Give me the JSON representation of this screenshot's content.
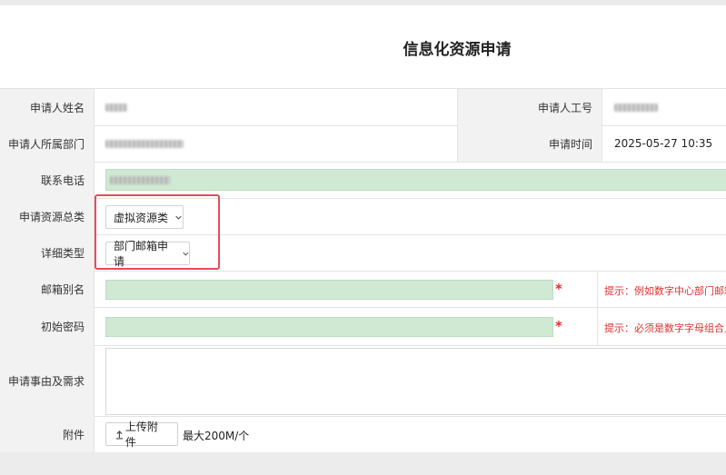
{
  "page": {
    "title": "信息化资源申请"
  },
  "fields": {
    "applicant_name": {
      "label": "申请人姓名"
    },
    "employee_id": {
      "label": "申请人工号"
    },
    "department": {
      "label": "申请人所属部门"
    },
    "apply_time": {
      "label": "申请时间",
      "value": "2025-05-27 10:35"
    },
    "phone": {
      "label": "联系电话"
    },
    "resource_category": {
      "label": "申请资源总类",
      "value": "虚拟资源类"
    },
    "detail_type": {
      "label": "详细类型",
      "value": "部门邮箱申请"
    },
    "mailbox_alias": {
      "label": "邮箱别名",
      "required_mark": "*",
      "hint": "提示：例如数字中心部门邮箱"
    },
    "initial_password": {
      "label": "初始密码",
      "required_mark": "*",
      "hint": "提示：必须是数字字母组合且"
    },
    "reason": {
      "label": "申请事由及需求"
    },
    "attachment": {
      "label": "附件",
      "upload_label": "上传附件",
      "limit_text": "最大200M/个"
    }
  },
  "icons": {
    "select_arrow": "chevron-down-icon",
    "upload": "upload-arrow-icon"
  },
  "colors": {
    "input_green": "#cfe9d2",
    "required_red": "#e02f2f",
    "highlight_box": "#e94a5a"
  }
}
